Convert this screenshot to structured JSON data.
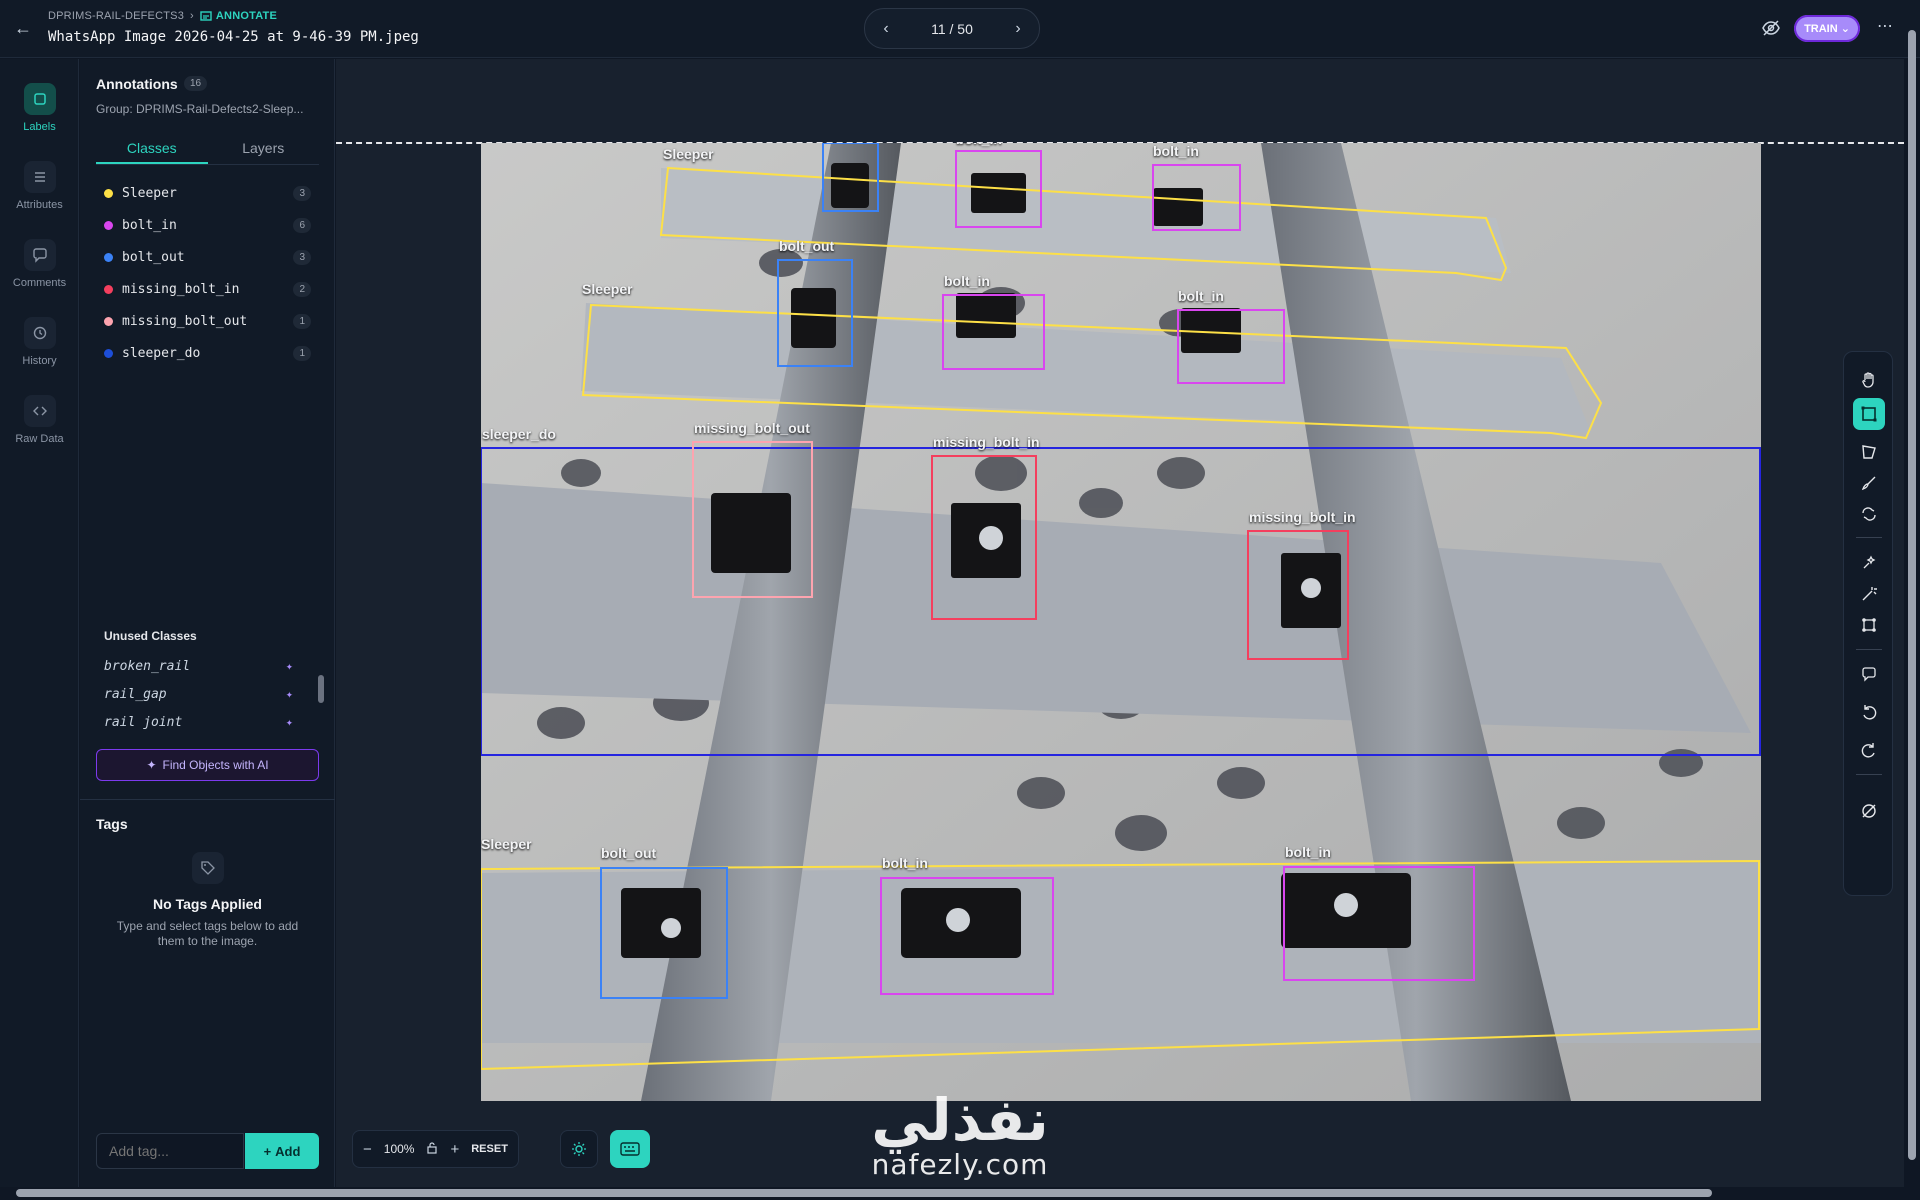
{
  "header": {
    "project": "DPRIMS-RAIL-DEFECTS3",
    "mode": "ANNOTATE",
    "filename": "WhatsApp Image 2026-04-25 at 9-46-39 PM.jpeg",
    "pager": "11 / 50",
    "train_label": "TRAIN"
  },
  "rail": [
    {
      "label": "Labels",
      "icon": "tag-icon"
    },
    {
      "label": "Attributes",
      "icon": "list-icon"
    },
    {
      "label": "Comments",
      "icon": "comment-icon"
    },
    {
      "label": "History",
      "icon": "history-icon"
    },
    {
      "label": "Raw Data",
      "icon": "code-icon"
    }
  ],
  "panel": {
    "title": "Annotations",
    "count": "16",
    "group": "Group: DPRIMS-Rail-Defects2-Sleep...",
    "tabs": [
      "Classes",
      "Layers"
    ],
    "classes": [
      {
        "name": "Sleeper",
        "count": "3",
        "color": "#fde047"
      },
      {
        "name": "bolt_in",
        "count": "6",
        "color": "#d946ef"
      },
      {
        "name": "bolt_out",
        "count": "3",
        "color": "#3b82f6"
      },
      {
        "name": "missing_bolt_in",
        "count": "2",
        "color": "#f43f5e"
      },
      {
        "name": "missing_bolt_out",
        "count": "1",
        "color": "#fda4af"
      },
      {
        "name": "sleeper_do",
        "count": "1",
        "color": "#1d4ed8"
      }
    ],
    "unused_title": "Unused Classes",
    "unused": [
      "broken_rail",
      "rail_gap",
      "rail joint"
    ],
    "find_label": "Find Objects with AI",
    "tags_title": "Tags",
    "no_tags": "No Tags Applied",
    "no_tags_sub": "Type and select tags below to add them to the image.",
    "tag_placeholder": "Add tag...",
    "add_label": "Add"
  },
  "annotations": [
    {
      "label": "bolt_out",
      "color": "#3b82f6"
    },
    {
      "label": "bolt_in",
      "color": "#d946ef"
    },
    {
      "label": "Sleeper",
      "color": "#fde047"
    },
    {
      "label": "bolt_in",
      "color": "#d946ef"
    },
    {
      "label": "bolt_out",
      "color": "#3b82f6"
    },
    {
      "label": "bolt_in",
      "color": "#d946ef"
    },
    {
      "label": "Sleeper",
      "color": "#fde047"
    },
    {
      "label": "bolt_in",
      "color": "#d946ef"
    },
    {
      "label": "sleeper_do",
      "color": "#1d1dd8"
    },
    {
      "label": "missing_bolt_out",
      "color": "#fda4af"
    },
    {
      "label": "missing_bolt_in",
      "color": "#f43f5e"
    },
    {
      "label": "missing_bolt_in",
      "color": "#f43f5e"
    },
    {
      "label": "Sleeper",
      "color": "#fde047"
    },
    {
      "label": "bolt_out",
      "color": "#3b82f6"
    },
    {
      "label": "bolt_in",
      "color": "#d946ef"
    },
    {
      "label": "bolt_in",
      "color": "#d946ef"
    }
  ],
  "zoom": {
    "value": "100%",
    "reset": "RESET"
  },
  "watermark": {
    "arabic": "نفذلي",
    "latin": "nafezly.com"
  }
}
